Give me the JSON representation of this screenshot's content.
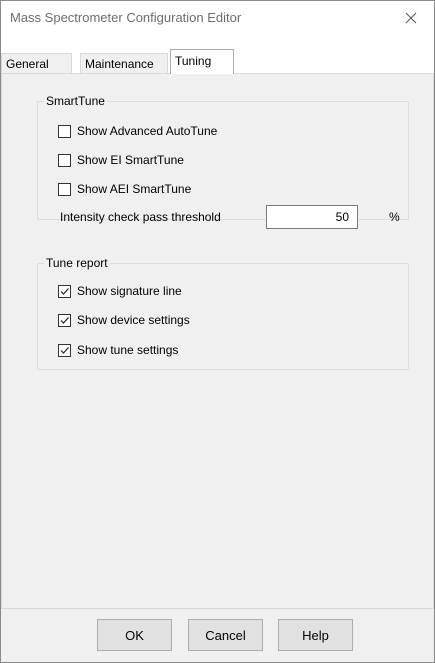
{
  "window": {
    "title": "Mass Spectrometer Configuration Editor",
    "close_icon": "close-icon"
  },
  "tabs": [
    {
      "label": "General",
      "active": false
    },
    {
      "label": "Maintenance",
      "active": false
    },
    {
      "label": "Tuning",
      "active": true
    }
  ],
  "smarttune": {
    "legend": "SmartTune",
    "options": [
      {
        "label": "Show Advanced AutoTune",
        "checked": false
      },
      {
        "label": "Show EI SmartTune",
        "checked": false
      },
      {
        "label": "Show AEI SmartTune",
        "checked": false
      }
    ],
    "threshold_label": "Intensity check pass threshold",
    "threshold_value": "50",
    "threshold_unit": "%"
  },
  "tune_report": {
    "legend": "Tune report",
    "options": [
      {
        "label": "Show signature line",
        "checked": true
      },
      {
        "label": "Show device settings",
        "checked": true
      },
      {
        "label": "Show tune settings",
        "checked": true
      }
    ]
  },
  "buttons": {
    "ok": "OK",
    "cancel": "Cancel",
    "help": "Help"
  }
}
